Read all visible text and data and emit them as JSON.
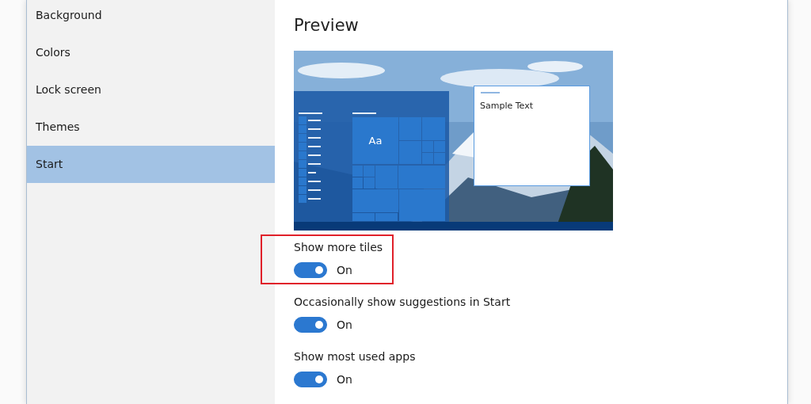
{
  "sidebar": {
    "items": [
      {
        "label": "Background",
        "selected": false
      },
      {
        "label": "Colors",
        "selected": false
      },
      {
        "label": "Lock screen",
        "selected": false
      },
      {
        "label": "Themes",
        "selected": false
      },
      {
        "label": "Start",
        "selected": true
      }
    ]
  },
  "content": {
    "heading": "Preview",
    "preview": {
      "kind": "picture",
      "tile_label": "Aa",
      "sample_text": "Sample Text"
    },
    "settings": [
      {
        "label": "Show more tiles",
        "on": true,
        "state_text": "On",
        "highlighted": true
      },
      {
        "label": "Occasionally show suggestions in Start",
        "on": true,
        "state_text": "On",
        "highlighted": false
      },
      {
        "label": "Show most used apps",
        "on": true,
        "state_text": "On",
        "highlighted": false
      }
    ]
  }
}
